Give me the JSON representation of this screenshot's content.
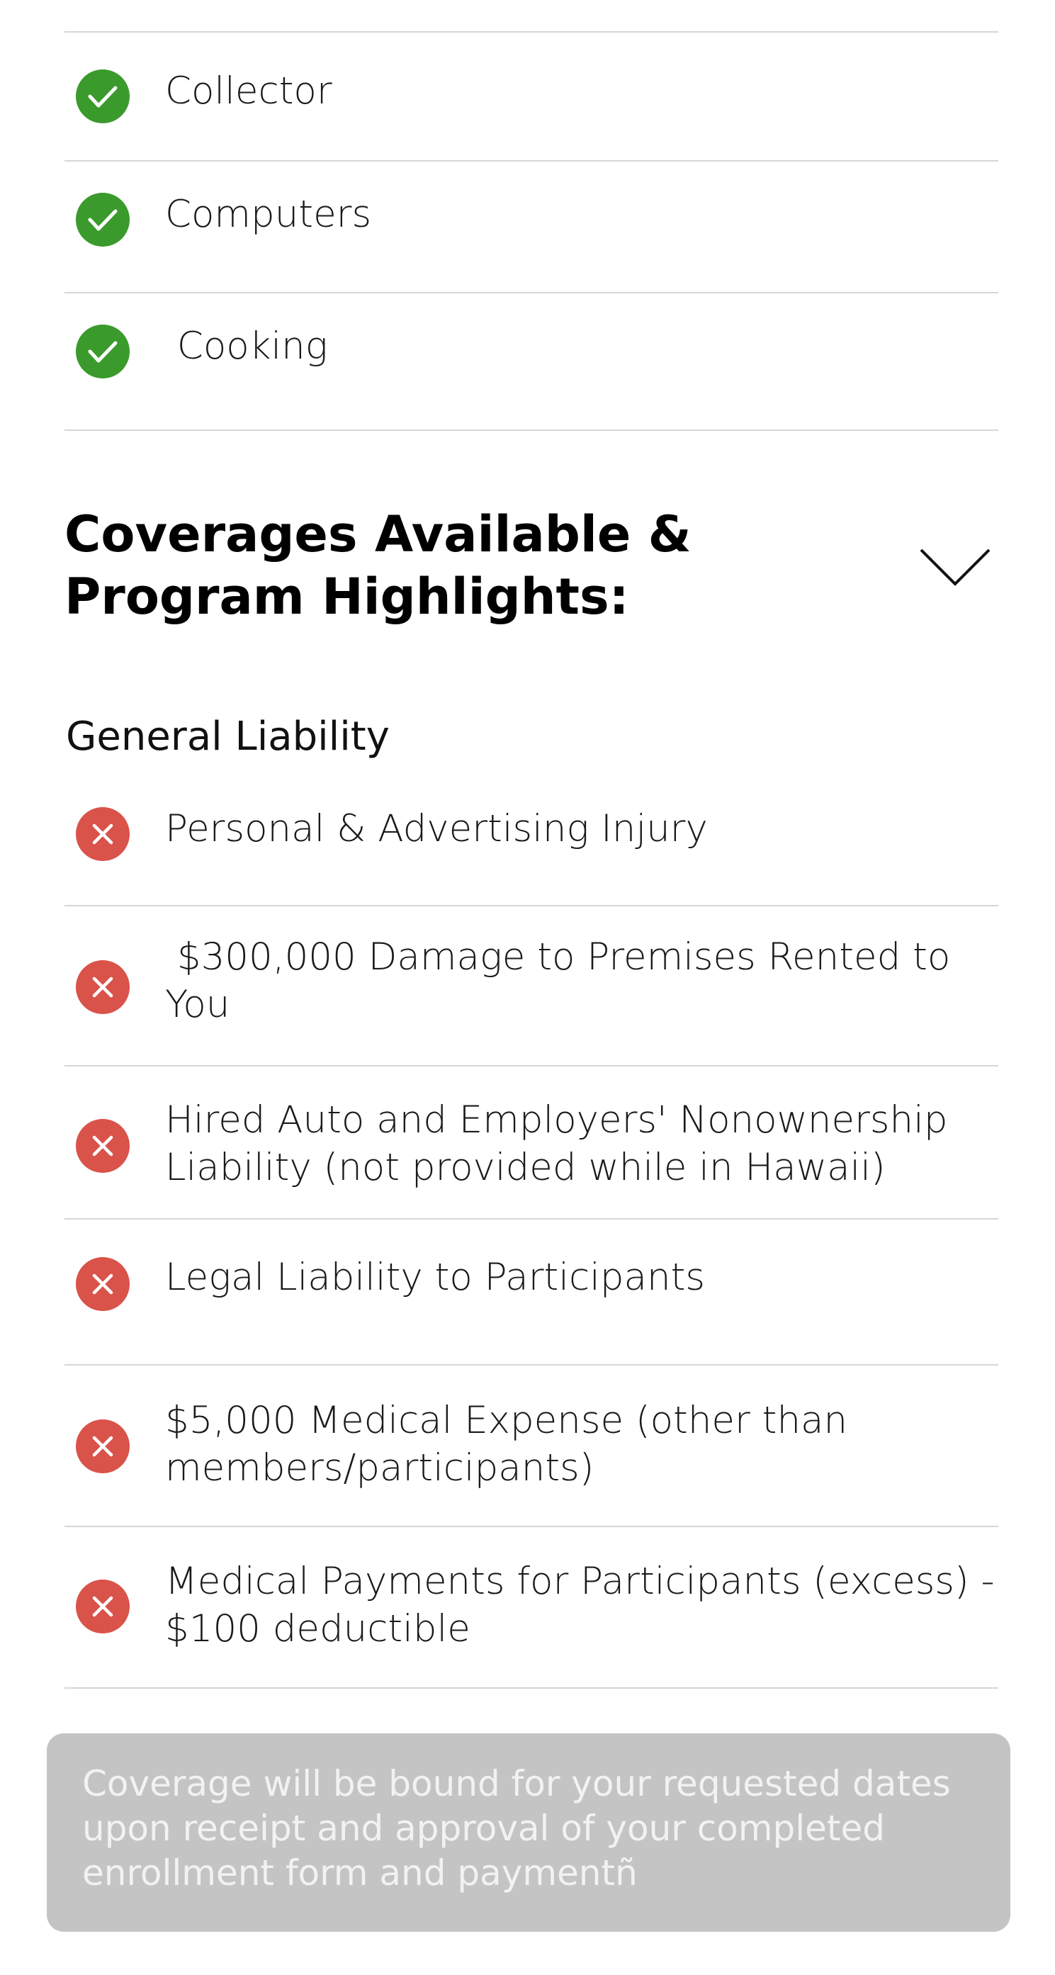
{
  "interests": [
    {
      "label": "Collector",
      "status": "included",
      "icon": "check-circle-icon"
    },
    {
      "label": "Computers",
      "status": "included",
      "icon": "check-circle-icon"
    },
    {
      "label": " Cooking",
      "status": "included",
      "icon": "check-circle-icon"
    }
  ],
  "section": {
    "title": "Coverages Available &\nProgram Highlights:",
    "toggle_icon": "chevron-down-icon"
  },
  "general_liability": {
    "heading": "General Liability",
    "items": [
      {
        "label": "Personal & Advertising Injury",
        "status": "excluded",
        "icon": "x-circle-icon"
      },
      {
        "label": " $300,000 Damage to Premises Rented to You",
        "status": "excluded",
        "icon": "x-circle-icon"
      },
      {
        "label": "Hired Auto and Employers' Nonownership Liability (not provided while in Hawaii)",
        "status": "excluded",
        "icon": "x-circle-icon"
      },
      {
        "label": "Legal Liability to Participants",
        "status": "excluded",
        "icon": "x-circle-icon"
      },
      {
        "label": "$5,000 Medical Expense (other than members/participants)",
        "status": "excluded",
        "icon": "x-circle-icon"
      },
      {
        "label": "Medical Payments for Participants (excess) - $100 deductible",
        "status": "excluded",
        "icon": "x-circle-icon"
      }
    ]
  },
  "notice": {
    "text": "Coverage will be bound for your requested dates upon receipt and approval of your completed enrollment form and paymentñ"
  },
  "colors": {
    "check": "#3a9a2b",
    "cross": "#d9534a",
    "divider": "#d6d6d6",
    "notice_bg": "#c4c4c4",
    "notice_text": "#f2f2f2"
  }
}
